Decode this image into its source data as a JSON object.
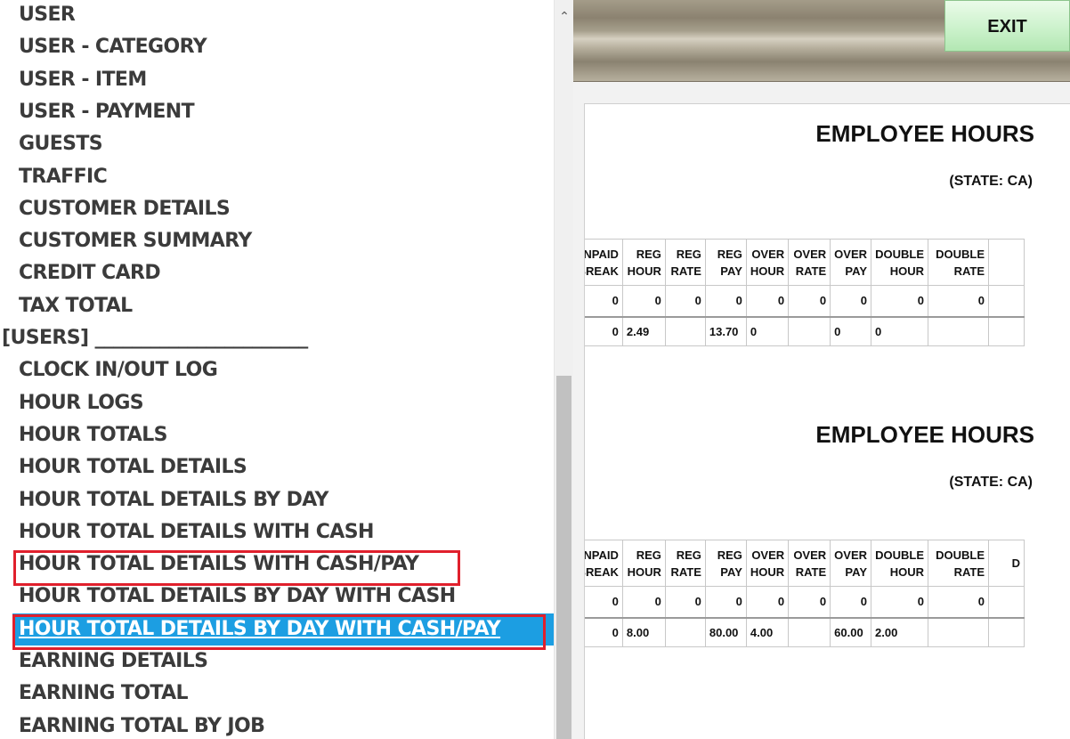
{
  "menu": {
    "items": [
      {
        "label": "USER"
      },
      {
        "label": "USER - CATEGORY"
      },
      {
        "label": "USER - ITEM"
      },
      {
        "label": "USER - PAYMENT"
      },
      {
        "label": "GUESTS"
      },
      {
        "label": "TRAFFIC"
      },
      {
        "label": "CUSTOMER DETAILS"
      },
      {
        "label": "CUSTOMER SUMMARY"
      },
      {
        "label": "CREDIT CARD"
      },
      {
        "label": "TAX TOTAL"
      },
      {
        "label": "[USERS] _______________________"
      },
      {
        "label": "CLOCK IN/OUT LOG"
      },
      {
        "label": "HOUR LOGS"
      },
      {
        "label": "HOUR TOTALS"
      },
      {
        "label": "HOUR TOTAL DETAILS"
      },
      {
        "label": "HOUR TOTAL DETAILS BY DAY"
      },
      {
        "label": "HOUR TOTAL DETAILS WITH CASH"
      },
      {
        "label": "HOUR TOTAL DETAILS WITH CASH/PAY"
      },
      {
        "label": "HOUR TOTAL DETAILS BY DAY WITH CASH"
      },
      {
        "label": "HOUR TOTAL DETAILS BY DAY WITH CASH/PAY"
      },
      {
        "label": "EARNING DETAILS"
      },
      {
        "label": "EARNING TOTAL"
      },
      {
        "label": "EARNING TOTAL BY JOB"
      }
    ],
    "selected_index": 19,
    "highlight_color": "#1c9ee2",
    "annotation_color": "#e0202c"
  },
  "scrollbar": {
    "up_icon": "chevron-up-icon"
  },
  "toolbar": {
    "exit_label": "EXIT"
  },
  "report": {
    "sections": [
      {
        "title": "EMPLOYEE HOURS",
        "state": "(STATE: CA)",
        "headers": [
          [
            "UNPAID",
            "BREAK"
          ],
          [
            "REG",
            "HOUR"
          ],
          [
            "REG",
            "RATE"
          ],
          [
            "REG",
            "PAY"
          ],
          [
            "OVER",
            "HOUR"
          ],
          [
            "OVER",
            "RATE"
          ],
          [
            "OVER",
            "PAY"
          ],
          [
            "DOUBLE",
            "HOUR"
          ],
          [
            "DOUBLE",
            "RATE"
          ],
          [
            "",
            ""
          ]
        ],
        "row": [
          "0",
          "0",
          "0",
          "0",
          "0",
          "0",
          "0",
          "0",
          "0",
          ""
        ],
        "total": [
          "0",
          "2.49",
          "",
          "13.70",
          "0",
          "",
          "0",
          "0",
          "",
          ""
        ]
      },
      {
        "title": "EMPLOYEE HOURS",
        "state": "(STATE: CA)",
        "headers": [
          [
            "UNPAID",
            "BREAK"
          ],
          [
            "REG",
            "HOUR"
          ],
          [
            "REG",
            "RATE"
          ],
          [
            "REG",
            "PAY"
          ],
          [
            "OVER",
            "HOUR"
          ],
          [
            "OVER",
            "RATE"
          ],
          [
            "OVER",
            "PAY"
          ],
          [
            "DOUBLE",
            "HOUR"
          ],
          [
            "DOUBLE",
            "RATE"
          ],
          [
            "D",
            ""
          ]
        ],
        "row": [
          "0",
          "0",
          "0",
          "0",
          "0",
          "0",
          "0",
          "0",
          "0",
          ""
        ],
        "total": [
          "0",
          "8.00",
          "",
          "80.00",
          "4.00",
          "",
          "60.00",
          "2.00",
          "",
          ""
        ]
      }
    ]
  }
}
